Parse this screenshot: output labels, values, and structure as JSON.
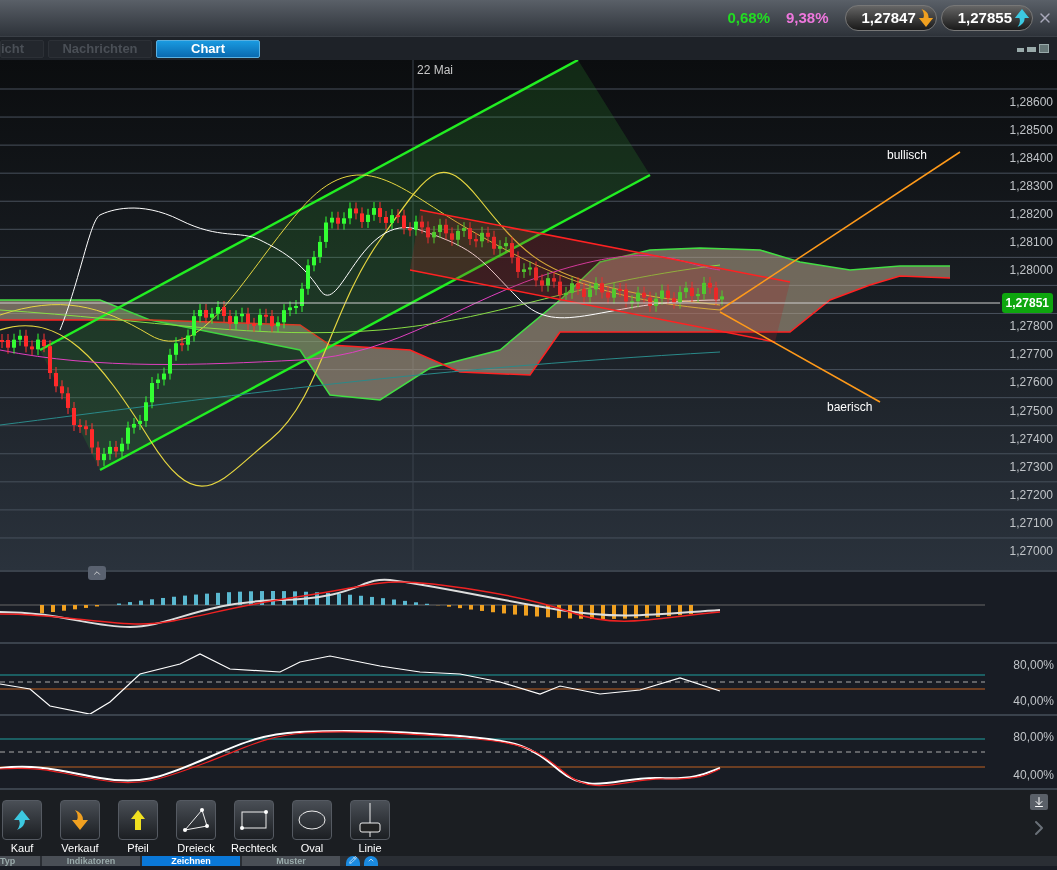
{
  "header": {
    "change_percent": "0,68%",
    "spread_percent": "9,38%",
    "sell_price": "1,27847",
    "buy_price": "1,27855"
  },
  "tabs": [
    {
      "label": "icht",
      "selected": false
    },
    {
      "label": "Nachrichten",
      "selected": false
    },
    {
      "label": "Chart",
      "selected": true
    }
  ],
  "chart": {
    "date_label": "22 Mai",
    "price_axis_upper": [
      "1,28600",
      "1,28500",
      "1,28400",
      "1,28300",
      "1,28200",
      "1,28100",
      "1,28000"
    ],
    "price_axis_lower": [
      "1,27800",
      "1,27700",
      "1,27600",
      "1,27500",
      "1,27400",
      "1,27300",
      "1,27200",
      "1,27100",
      "1,27000"
    ],
    "current_price": "1,27851",
    "annotations": [
      "bullisch",
      "baerisch"
    ]
  },
  "indicators": [
    {
      "kind": "macd"
    },
    {
      "kind": "oscillator",
      "levels": [
        "80,00%",
        "40,00%"
      ]
    },
    {
      "kind": "stochastic",
      "levels": [
        "80,00%",
        "40,00%"
      ]
    }
  ],
  "tools": [
    {
      "kind": "buy",
      "label": "Kauf"
    },
    {
      "kind": "sell",
      "label": "Verkauf"
    },
    {
      "kind": "arrow",
      "label": "Pfeil"
    },
    {
      "kind": "triangle",
      "label": "Dreieck"
    },
    {
      "kind": "rectangle",
      "label": "Rechteck"
    },
    {
      "kind": "oval",
      "label": "Oval"
    },
    {
      "kind": "line",
      "label": "Linie"
    }
  ],
  "bottom_tabs": [
    {
      "label": "Typ",
      "selected": false
    },
    {
      "label": "Indikatoren",
      "selected": false
    },
    {
      "label": "Zeichnen",
      "selected": true
    },
    {
      "label": "Muster",
      "selected": false
    }
  ]
}
